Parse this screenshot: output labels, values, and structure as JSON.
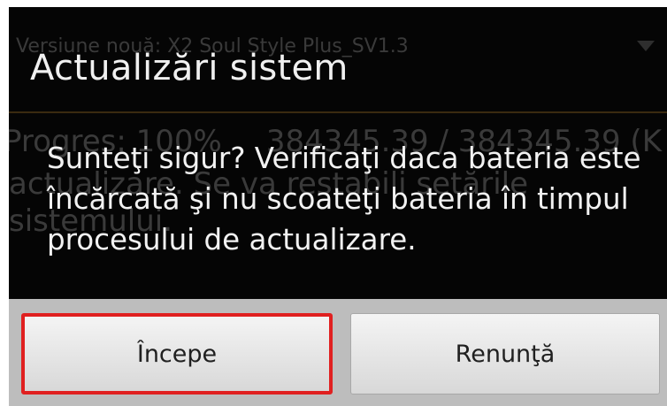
{
  "background": {
    "version_text": "Versiune nouă: X2 Soul Style Plus_SV1.3",
    "progress_text": "Progres: 100%",
    "size_text": "384345.39 / 384345.39 (K",
    "description_line1": "actualizare. Se va restabili setările",
    "description_line2": "sistemului."
  },
  "dialog": {
    "title": "Actualizări sistem",
    "message": "Sunteţi sigur? Verificaţi daca bateria este încărcată şi nu scoateţi bateria în timpul procesului de actualizare."
  },
  "buttons": {
    "start_label": "Începe",
    "cancel_label": "Renunţă"
  },
  "colors": {
    "dialog_background": "#050505",
    "button_bar": "#bdbdbd",
    "highlight": "#e02020"
  }
}
